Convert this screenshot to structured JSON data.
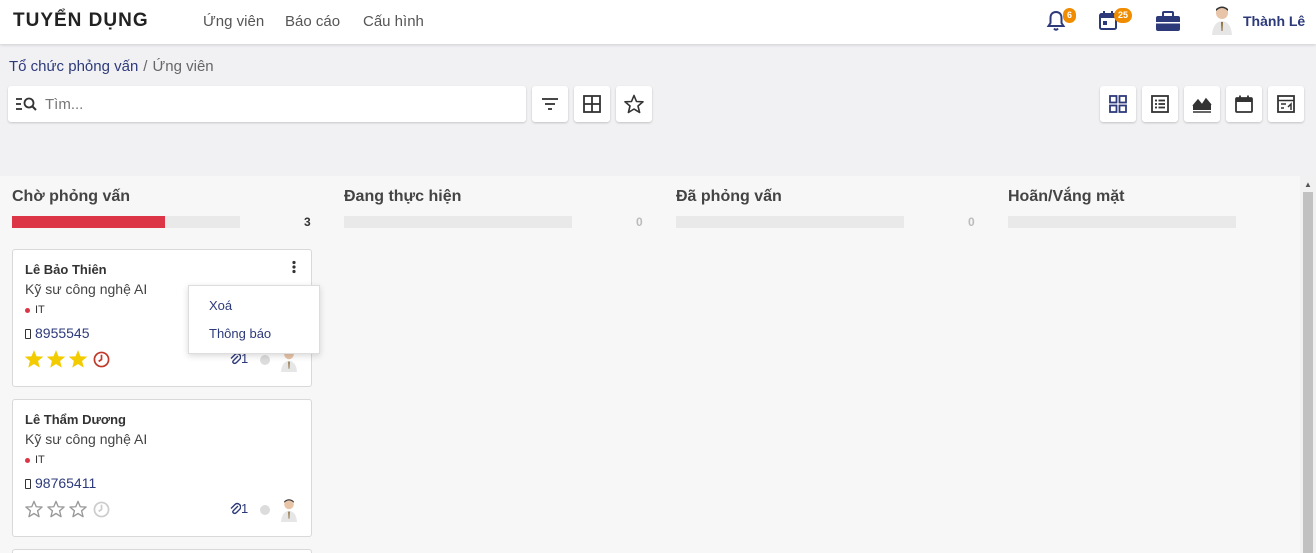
{
  "app": {
    "title": "TUYỂN DỤNG"
  },
  "nav": {
    "items": [
      "Ứng viên",
      "Báo cáo",
      "Cấu hình"
    ]
  },
  "topbar": {
    "notifications_count": "6",
    "calendar_count": "25",
    "user_name": "Thành Lê"
  },
  "breadcrumb": {
    "parent": "Tổ chức phỏng vấn",
    "separator": "/",
    "current": "Ứng viên"
  },
  "search": {
    "placeholder": "Tìm...",
    "value": ""
  },
  "columns": [
    {
      "title": "Chờ phỏng vấn",
      "count": "3",
      "progress": 0.67,
      "bar_color": "#dc3545"
    },
    {
      "title": "Đang thực hiện",
      "count": "0",
      "progress": 0
    },
    {
      "title": "Đã phỏng vấn",
      "count": "0",
      "progress": 0
    },
    {
      "title": "Hoãn/Vắng mặt",
      "count": "",
      "progress": 0
    }
  ],
  "cards": [
    {
      "name": "Lê Bảo Thiên",
      "job": "Kỹ sư công nghệ AI",
      "tag": "IT",
      "phone": "8955545",
      "stars": 3,
      "attachments": "1",
      "clock_color": "#c0392b"
    },
    {
      "name": "Lê Thẩm Dương",
      "job": "Kỹ sư công nghệ AI",
      "tag": "IT",
      "phone": "98765411",
      "stars": 0,
      "attachments": "1",
      "clock_color": "#cccccc"
    }
  ],
  "dropdown": {
    "items": [
      "Xoá",
      "Thông báo"
    ]
  },
  "colors": {
    "accent": "#2d3a7a",
    "danger": "#dc3545",
    "badge": "#f08c00",
    "star": "#f3cc00"
  }
}
